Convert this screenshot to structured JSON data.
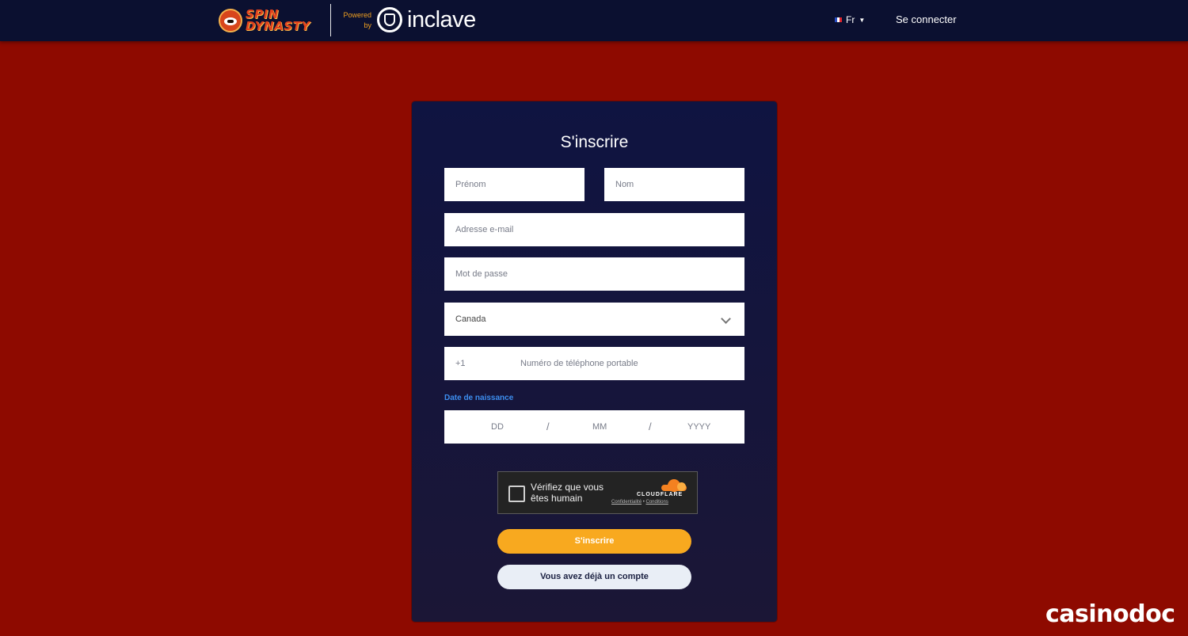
{
  "header": {
    "brand_text": "SPIN DYNASTY",
    "powered_line1": "Powered",
    "powered_line2": "by",
    "partner_name": "inclave",
    "language": "Fr",
    "login_label": "Se connecter"
  },
  "form": {
    "title": "S'inscrire",
    "first_name_placeholder": "Prénom",
    "last_name_placeholder": "Nom",
    "email_placeholder": "Adresse e-mail",
    "password_placeholder": "Mot de passe",
    "country_value": "Canada",
    "phone_prefix": "+1",
    "phone_placeholder": "Numéro de téléphone portable",
    "dob_label": "Date de naissance",
    "dob_day": "DD",
    "dob_month": "MM",
    "dob_year": "YYYY",
    "dob_separator": "/"
  },
  "captcha": {
    "line1": "Vérifiez que vous",
    "line2": "êtes humain",
    "brand": "CLOUDFLARE",
    "privacy_link": "Confidentialité",
    "link_separator": "•",
    "terms_link": "Conditions"
  },
  "buttons": {
    "signup_label": "S'inscrire",
    "have_account_label": "Vous avez déjà un compte"
  },
  "watermark": "casinodoc",
  "colors": {
    "background": "#8e0a00",
    "topbar": "#0b1030",
    "card": "#0f1441",
    "accent_orange": "#f8a91f",
    "label_blue": "#3d8ef0"
  },
  "icons": {
    "brand_logo": "red-panda-icon",
    "partner_logo": "shield-icon",
    "language_flag": "flag-france-icon",
    "country_dropdown": "chevron-down-icon",
    "captcha_checkbox": "checkbox-icon",
    "captcha_logo": "cloudflare-cloud-icon"
  }
}
